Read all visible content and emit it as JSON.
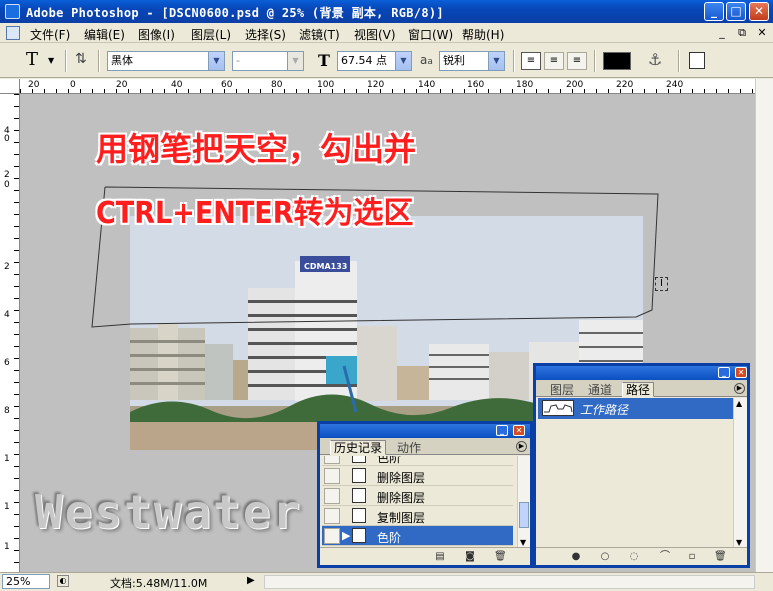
{
  "window": {
    "title": "Adobe Photoshop - [DSCN0600.psd @ 25% (背景 副本, RGB/8)]",
    "minimize": "_",
    "maximize": "□",
    "close": "✕"
  },
  "menu": {
    "items": [
      "文件(F)",
      "编辑(E)",
      "图像(I)",
      "图层(L)",
      "选择(S)",
      "滤镜(T)",
      "视图(V)",
      "窗口(W)",
      "帮助(H)"
    ],
    "doc_minimize": "_",
    "doc_restore": "⧉",
    "doc_close": "✕"
  },
  "options": {
    "tool_glyph": "T",
    "font_family": "黑体",
    "font_style": "-",
    "font_size": "67.54 点",
    "aa_label": "a",
    "aa_mode": "锐利",
    "color": "#000000"
  },
  "rulers": {
    "h_labels": [
      "20",
      "0",
      "20",
      "40",
      "60",
      "80",
      "100",
      "120",
      "140",
      "160",
      "180",
      "200",
      "220",
      "240"
    ],
    "v_labels": [
      "4",
      "0",
      "2",
      "0",
      "2",
      "4",
      "6",
      "8",
      "1",
      "1",
      "1"
    ]
  },
  "canvas": {
    "annotation_line1": "用钢笔把天空，勾出并",
    "annotation_line2": "CTRL+ENTER转为选区",
    "watermark": "Westwater",
    "building_sign": "CDMA133"
  },
  "history_panel": {
    "tabs": [
      "历史记录",
      "动作"
    ],
    "rows": [
      {
        "label": "色阶",
        "selected": false,
        "partial": true
      },
      {
        "label": "删除图层",
        "selected": false
      },
      {
        "label": "删除图层",
        "selected": false
      },
      {
        "label": "复制图层",
        "selected": false
      },
      {
        "label": "色阶",
        "selected": true
      }
    ]
  },
  "paths_panel": {
    "tabs": [
      "图层",
      "通道",
      "路径"
    ],
    "rows": [
      {
        "label": "工作路径",
        "selected": true
      }
    ]
  },
  "status": {
    "zoom": "25%",
    "doc_info": "文档:5.48M/11.0M"
  },
  "colors": {
    "xp_blue": "#0a3fa5",
    "selection": "#316ac5",
    "annotation_red": "#ff1e1e"
  }
}
